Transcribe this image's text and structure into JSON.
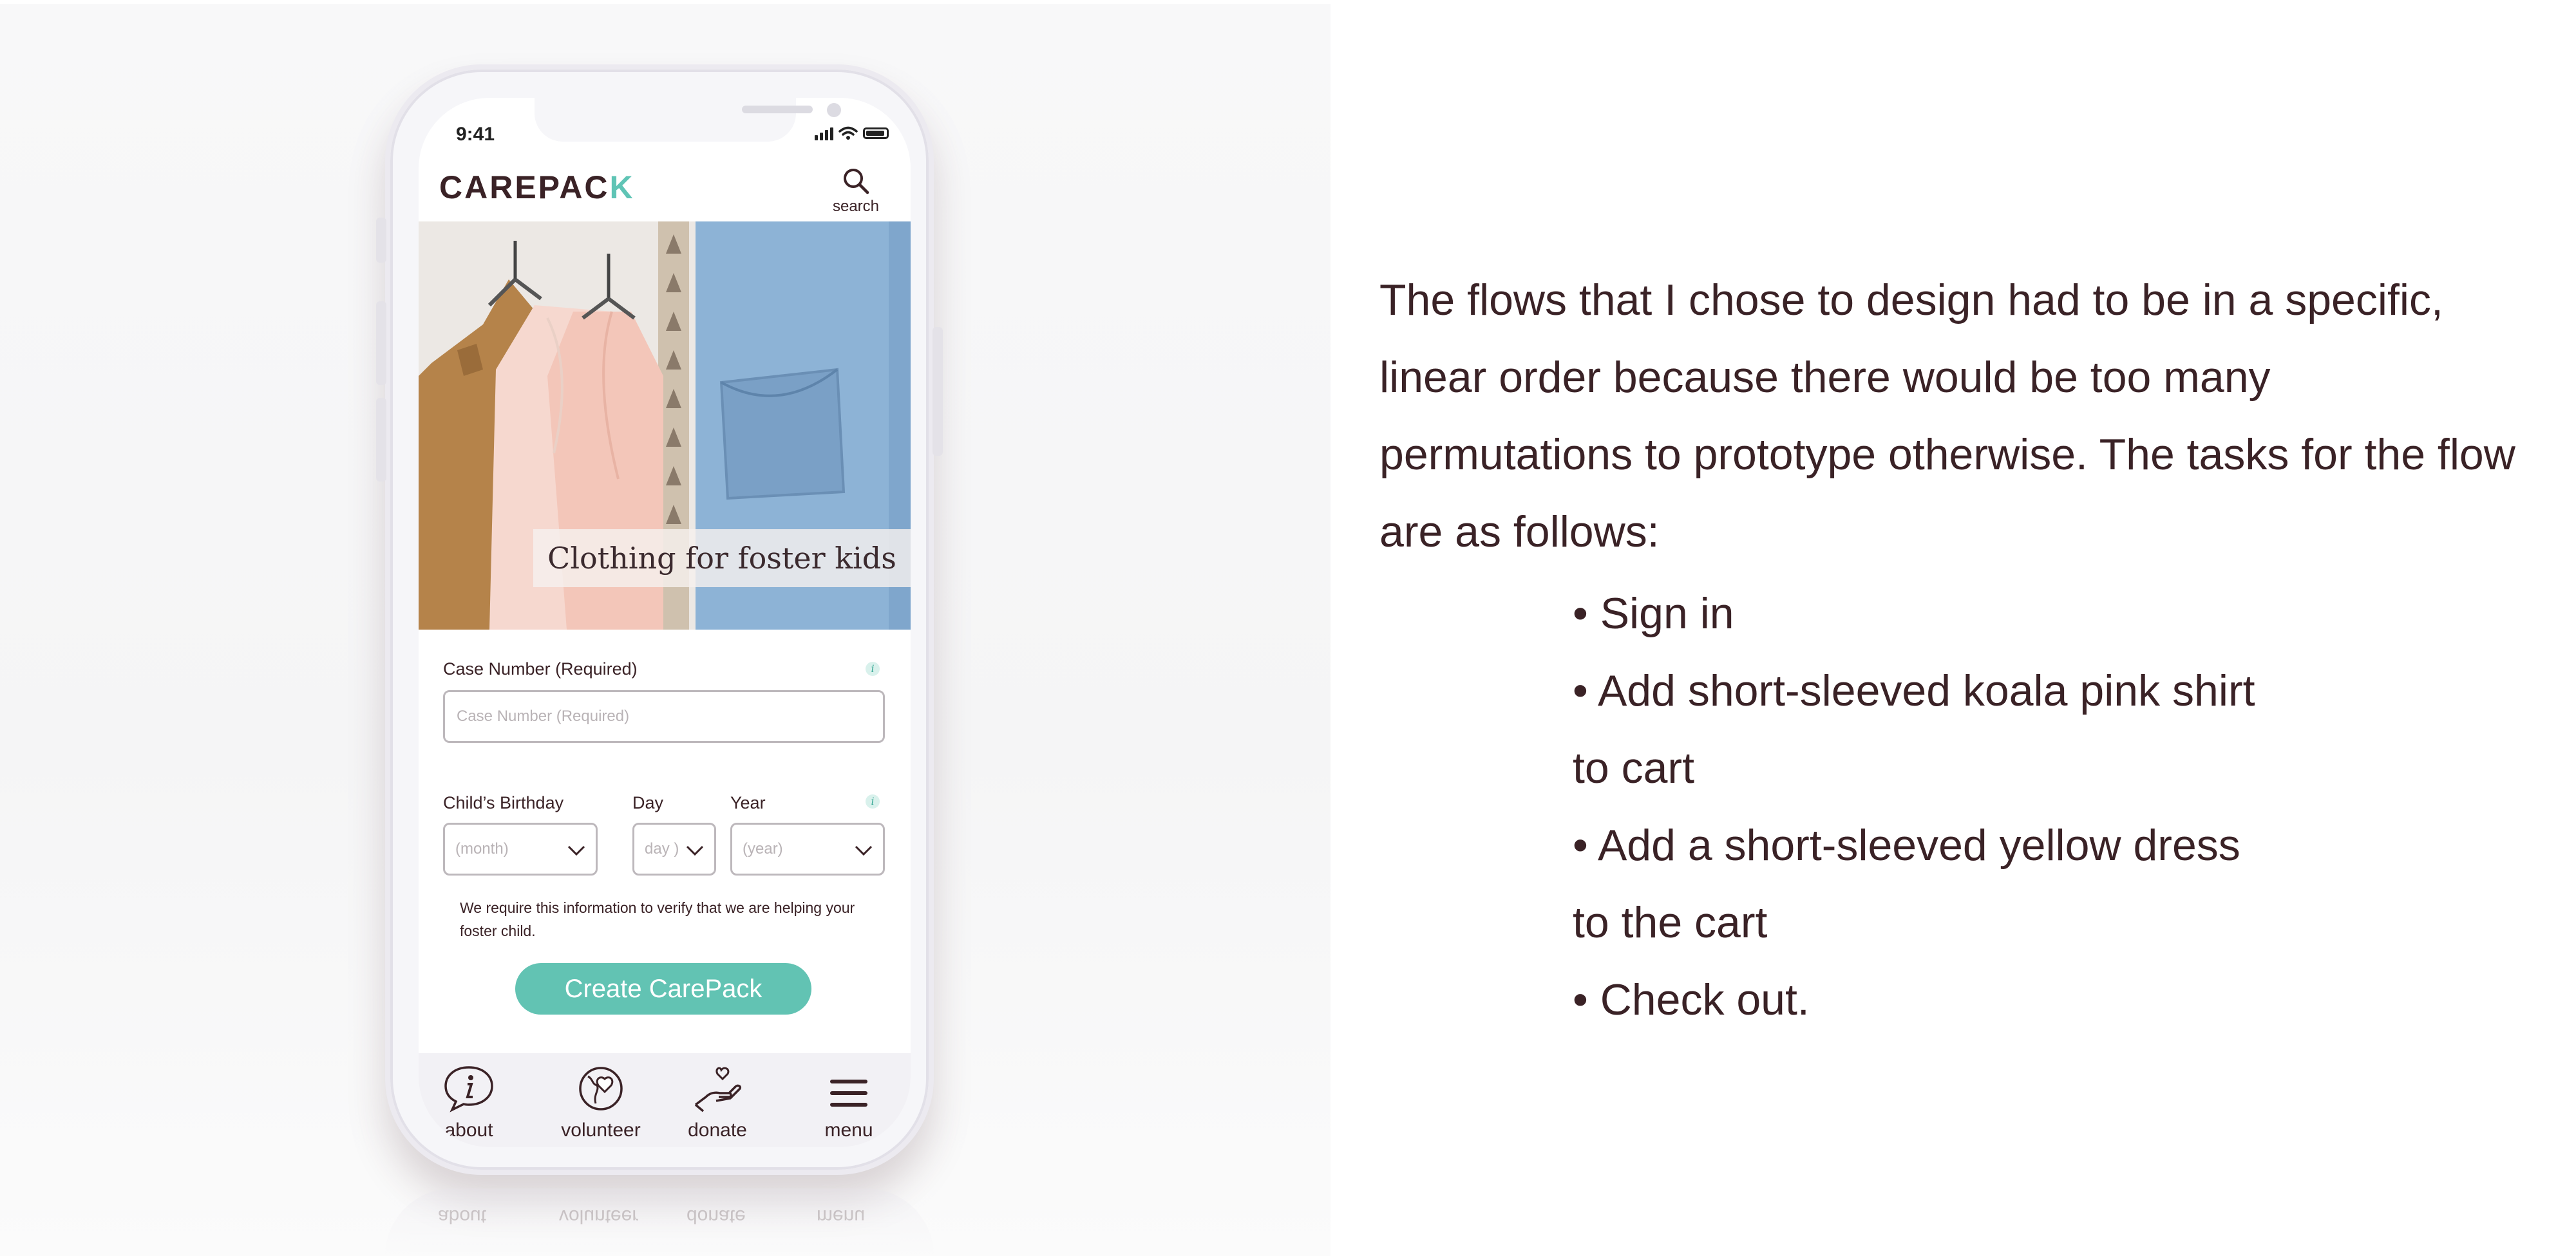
{
  "status_bar": {
    "time": "9:41"
  },
  "app": {
    "logo_text": "CAREPAC",
    "logo_accent": "K",
    "search_label": "search"
  },
  "hero": {
    "caption": "Clothing for foster kids"
  },
  "form": {
    "case_number_label": "Case Number (Required)",
    "case_number_placeholder": "Case Number (Required)",
    "birthday_label": "Child’s Birthday",
    "day_label": "Day",
    "year_label": "Year",
    "month_value": "(month)",
    "day_value": "day )",
    "year_value": "(year)",
    "helper_text": "We require this information to verify that we are helping your foster child.",
    "submit_label": "Create CarePack"
  },
  "tabbar": {
    "items": [
      {
        "label": "about",
        "icon": "info-bubble-icon"
      },
      {
        "label": "volunteer",
        "icon": "globe-heart-icon"
      },
      {
        "label": "donate",
        "icon": "hand-heart-icon"
      },
      {
        "label": "menu",
        "icon": "hamburger-menu-icon"
      }
    ]
  },
  "description": {
    "paragraph": "The flows that I chose to design had to be in a specific, linear order because there would be too many permutations to prototype otherwise. The tasks for the flow are as follows:",
    "tasks": [
      "• Sign in",
      "• Add  short-sleeved koala pink shirt to cart",
      "• Add a short-sleeved yellow dress to the cart",
      "• Check out."
    ]
  },
  "colors": {
    "brand_teal": "#62c3b3",
    "text_dark": "#3a2226",
    "phone_frame": "#f6f6f9"
  }
}
